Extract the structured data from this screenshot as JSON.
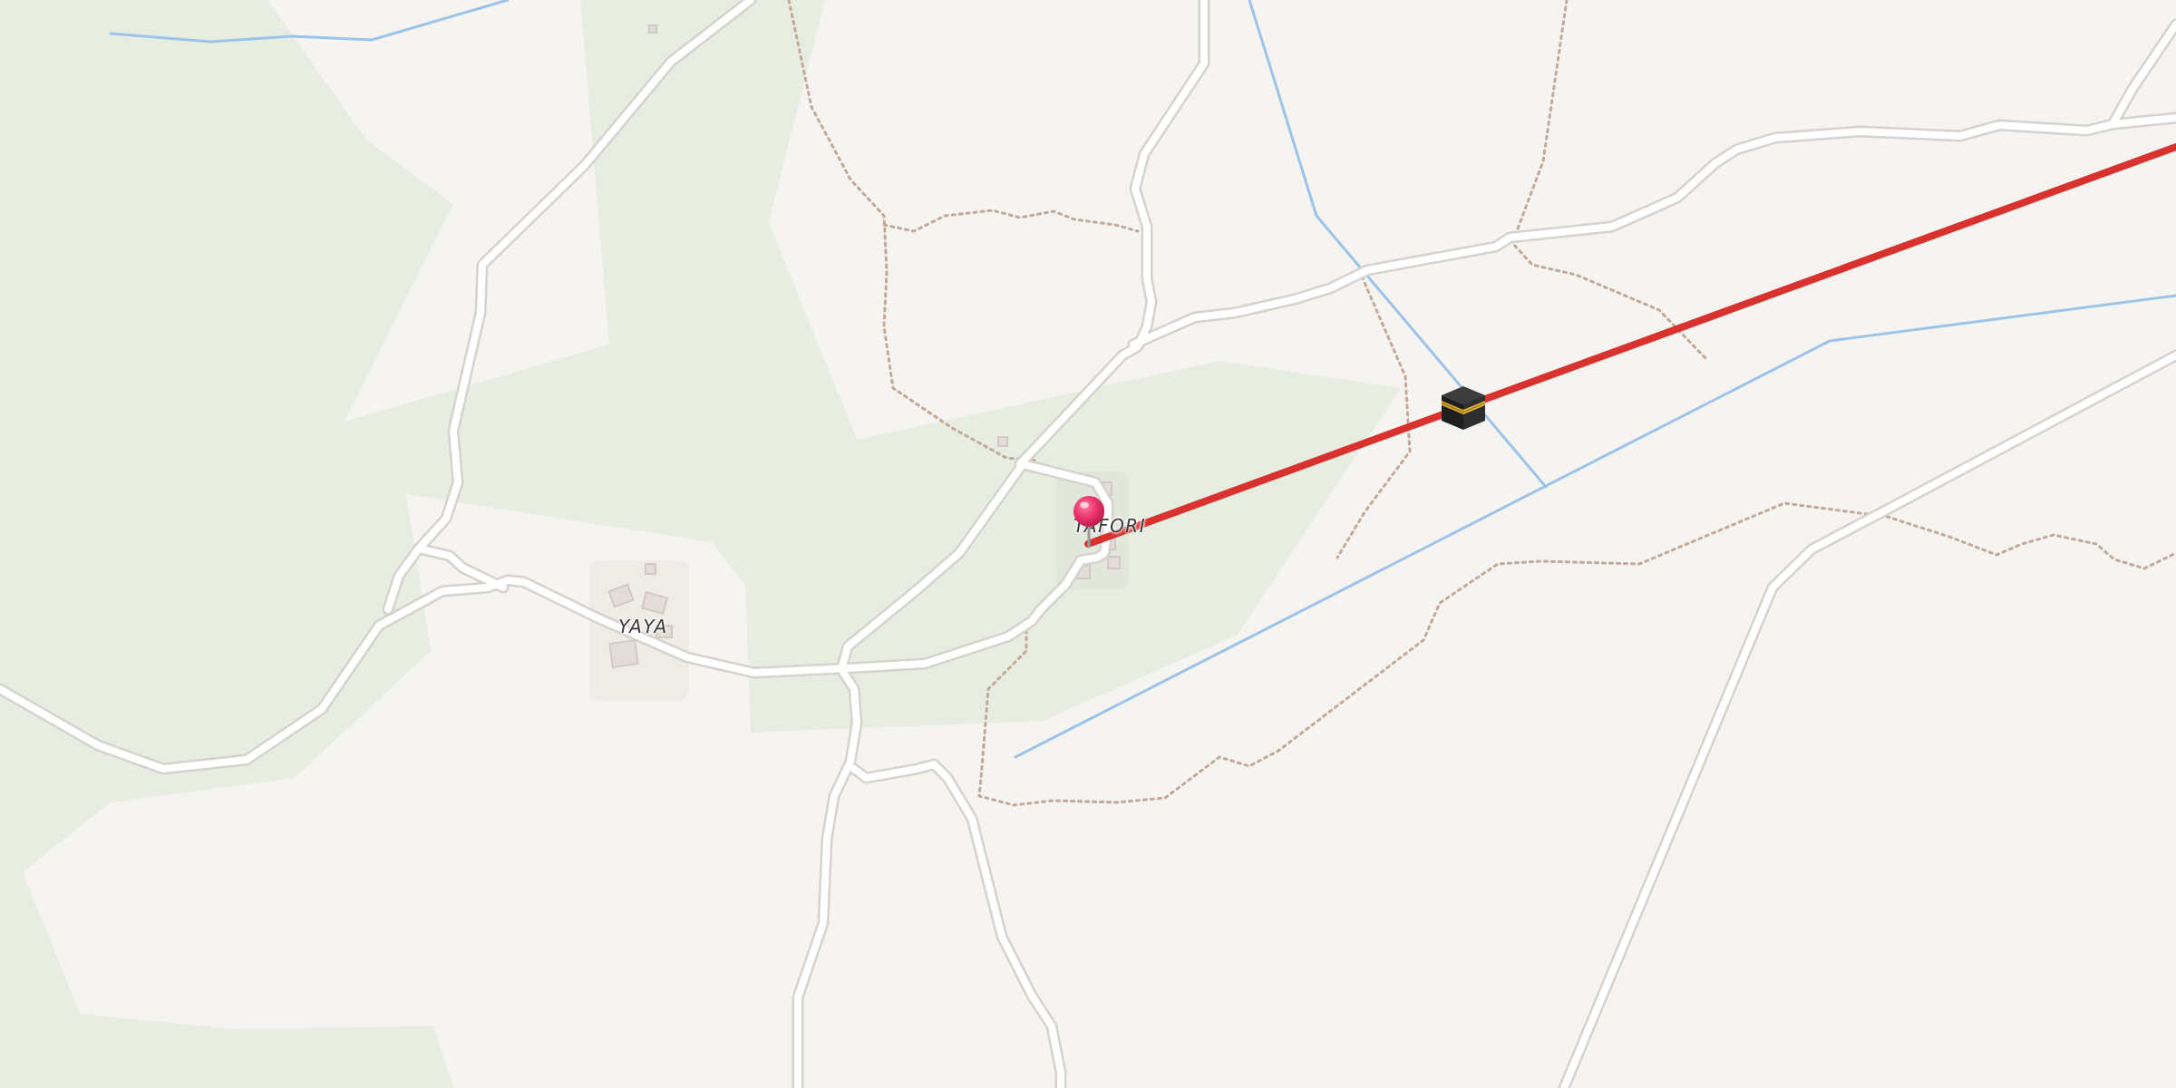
{
  "map": {
    "places": {
      "yaya": "YAYA",
      "tafori": "TAFORI"
    },
    "markers": {
      "location_pin": {
        "icon": "map-pin-icon",
        "color": "#e8316a"
      },
      "destination": {
        "icon": "kaaba-icon"
      }
    },
    "colors": {
      "land": "#f6f4f0",
      "vegetation": "#e8ede2",
      "road_fill": "#ffffff",
      "road_casing": "#d6d2cc",
      "water": "#9cc3ea",
      "path": "#c4a898",
      "route_line": "#d9322e"
    }
  }
}
